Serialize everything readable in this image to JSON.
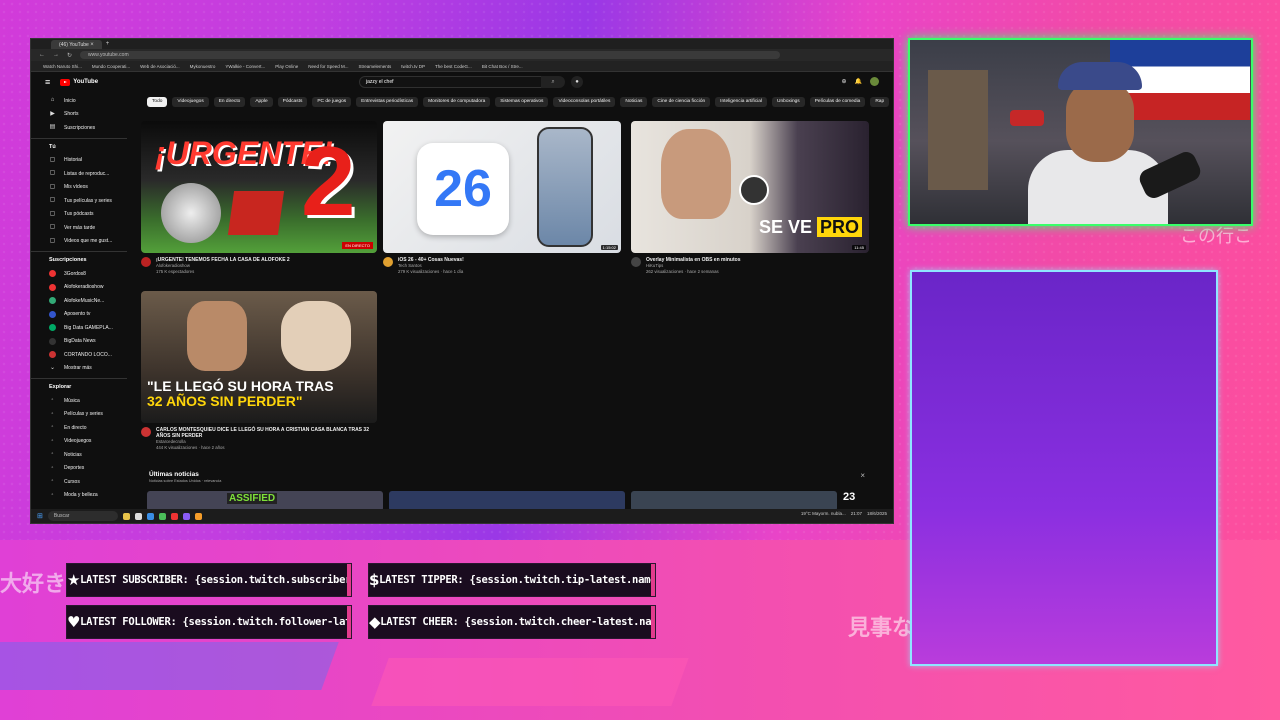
{
  "browser": {
    "tab_label": "(46) YouTube",
    "url": "www.youtube.com",
    "bookmarks": [
      "Watch Naruto Shi...",
      "Mundo Cooperati...",
      "Web de Asociació...",
      "Mykonuestro",
      "YWalkie - Convert...",
      "Play Online",
      "Need for Speed M...",
      "Streamelements",
      "twitch.tv DP",
      "The best CodeG...",
      "Bit Chat Box / Stre..."
    ]
  },
  "youtube": {
    "logo": "YouTube",
    "search_value": "jazzy el chef",
    "chips": [
      "Todo",
      "Videojuegos",
      "En directo",
      "Apple",
      "Pódcasts",
      "PC de juegos",
      "Entrevistas periodísticas",
      "Monitores de computadora",
      "Sistemas operativos",
      "Videoconsolas portátiles",
      "Noticias",
      "Cine de ciencia ficción",
      "Inteligencia artificial",
      "Unboxings",
      "Películas de comedia",
      "Rap"
    ],
    "sidebar": {
      "main": [
        "Inicio",
        "Shorts",
        "Suscripciones"
      ],
      "you_head": "Tú",
      "you": [
        "Historial",
        "Listas de reproduc...",
        "Mis vídeos",
        "Tus películas y series",
        "Tus pódcasts",
        "Ver más tarde",
        "Videos que me gust..."
      ],
      "subs_head": "Suscripciones",
      "subs": [
        "3Gordos8",
        "Alofokeradioshow",
        "AlofokeMusicNe...",
        "Aposento tv",
        "Big Data GAMEPLA...",
        "BigData News",
        "CORTANDO LOCO..."
      ],
      "show_more": "Mostrar más",
      "explore_head": "Explorar",
      "explore": [
        "Música",
        "Películas y series",
        "En directo",
        "Videojuegos",
        "Noticias",
        "Deportes",
        "Cursos",
        "Moda y belleza"
      ]
    },
    "videos": [
      {
        "title": "¡URGENTE! TENEMOS FECHA LA CASA DE ALOFOKE 2",
        "channel": "Alofokeradioshow",
        "stats": "175 K espectadores",
        "badge": "EN DIRECTO",
        "thumb_text": "¡URGENTE!",
        "thumb_num": "2"
      },
      {
        "title": "iOS 26 - 40+ Cosas Nuevas!",
        "channel": "Tech Santos",
        "stats": "279 K visualizaciones · hace 1 día",
        "duration": "1:15:02",
        "thumb_text": "26"
      },
      {
        "title": "Overlay Minimalista en OBS en minutos",
        "channel": "HiKuTips",
        "stats": "262 visualizaciones · hace 2 semanas",
        "duration": "11:45",
        "thumb_text": "SE VE",
        "thumb_pro": "PRO"
      },
      {
        "title": "CARLOS MONTESQUIEU DICE LE LLEGÓ SU HORA A CRISTIAN CASA BLANCA TRAS 32 AÑOS SIN PERDER",
        "channel": "Estarcedecrolla",
        "stats": "444 K visualizaciones · hace 2 años",
        "thumb_line1": "\"LE LLEGÓ SU HORA TRAS",
        "thumb_line2": "32 AÑOS SIN PERDER\""
      }
    ],
    "news_head": "Últimas noticias",
    "news_sub": "Noticias sobre Estados Unidos · relevancia",
    "news_thumb_text": "ASSIFIED",
    "news_badge": "23"
  },
  "taskbar": {
    "search": "Buscar",
    "weather": "19°C Mayorm. nubla...",
    "time": "21:07",
    "date": "18/6/2025"
  },
  "alerts": {
    "subscriber": "LATEST SUBSCRIBER: {session.twitch.subscriber-latest.name}",
    "tipper": "LATEST TIPPER: {session.twitch.tip-latest.name} - {session.twitch.tip-latest.amount}",
    "follower": "LATEST FOLLOWER: {session.twitch.follower-latest.name}",
    "cheer": "LATEST CHEER: {session.twitch.cheer-latest.name} - {session.twitch.cheer-latest.amount}"
  },
  "decor": {
    "jp1": "大好き",
    "jp2": "見事な",
    "jp3": "この行こ"
  }
}
